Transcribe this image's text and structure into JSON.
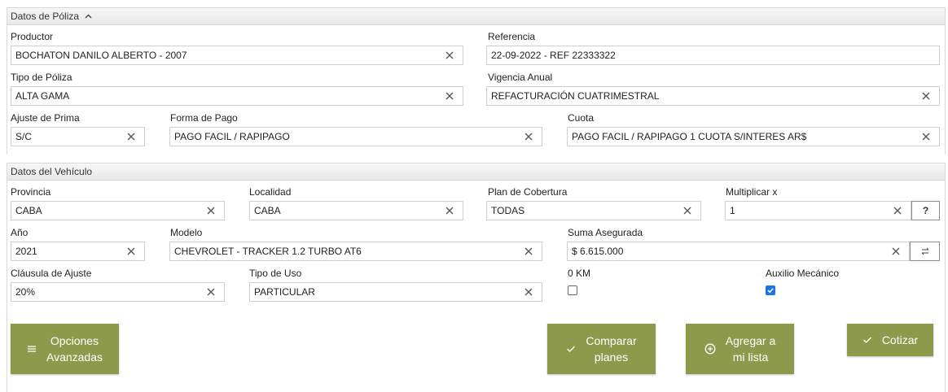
{
  "poliza": {
    "header": "Datos de Póliza",
    "productor": {
      "label": "Productor",
      "value": "BOCHATON DANILO ALBERTO - 2007"
    },
    "referencia": {
      "label": "Referencia",
      "value": "22-09-2022 - REF 22333322"
    },
    "tipo_poliza": {
      "label": "Tipo de Póliza",
      "value": "ALTA GAMA"
    },
    "vigencia": {
      "label": "Vigencia Anual",
      "value": "REFACTURACIÓN CUATRIMESTRAL"
    },
    "ajuste_prima": {
      "label": "Ajuste de Prima",
      "value": "S/C"
    },
    "forma_pago": {
      "label": "Forma de Pago",
      "value": "PAGO FACIL / RAPIPAGO"
    },
    "cuota": {
      "label": "Cuota",
      "value": "PAGO FACIL / RAPIPAGO 1 CUOTA S/INTERES AR$"
    }
  },
  "vehiculo": {
    "header": "Datos del Vehículo",
    "provincia": {
      "label": "Provincia",
      "value": "CABA"
    },
    "localidad": {
      "label": "Localidad",
      "value": "CABA"
    },
    "plan": {
      "label": "Plan de Cobertura",
      "value": "TODAS"
    },
    "multiplicar": {
      "label": "Multiplicar x",
      "value": "1",
      "help": "?"
    },
    "anio": {
      "label": "Año",
      "value": "2021"
    },
    "modelo": {
      "label": "Modelo",
      "value": "CHEVROLET - TRACKER 1.2 TURBO AT6"
    },
    "suma": {
      "label": "Suma Asegurada",
      "value": "$ 6.615.000"
    },
    "clausula": {
      "label": "Cláusula de Ajuste",
      "value": "20%"
    },
    "tipo_uso": {
      "label": "Tipo de Uso",
      "value": "PARTICULAR"
    },
    "cero_km": {
      "label": "0 KM",
      "checked": false
    },
    "auxilio": {
      "label": "Auxilio Mecánico",
      "checked": true
    }
  },
  "buttons": {
    "opciones_line1": "Opciones",
    "opciones_line2": "Avanzadas",
    "comparar_line1": "Comparar",
    "comparar_line2": "planes",
    "agregar_line1": "Agregar a",
    "agregar_line2": "mi lista",
    "cotizar": "Cotizar"
  },
  "colors": {
    "accent": "#8d9a4c",
    "checkbox": "#1a73e8"
  },
  "icons": {
    "collapse": "chevron-up-icon",
    "clear": "close-icon",
    "swap": "swap-icon",
    "menu": "menu-icon",
    "check": "check-icon",
    "add": "plus-circle-icon"
  }
}
